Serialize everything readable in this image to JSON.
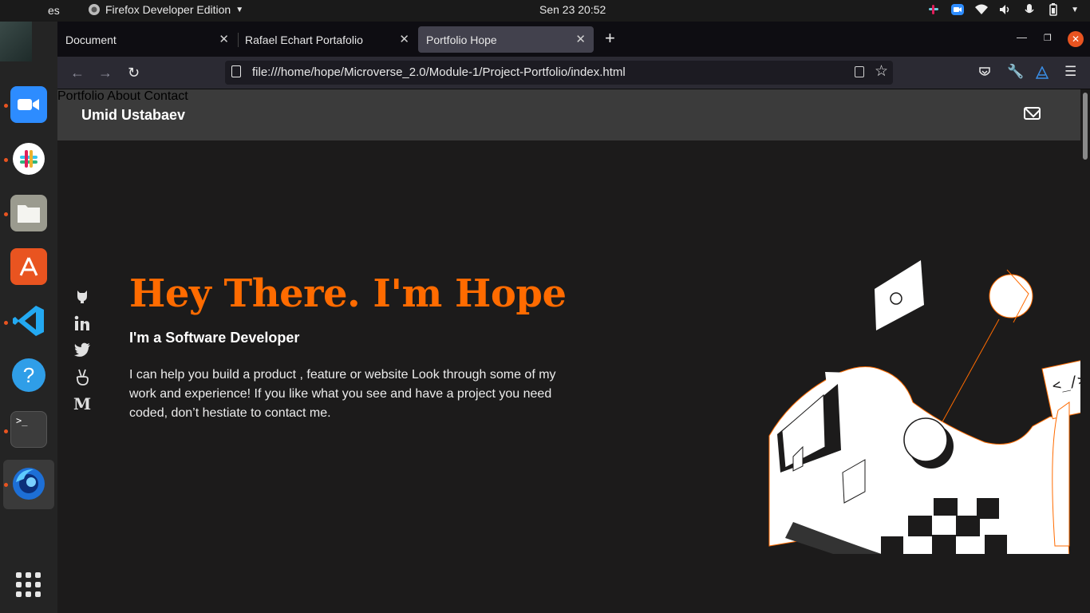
{
  "system": {
    "activities_label": "es",
    "app_menu_label": "Firefox Developer Edition",
    "clock": "Sen 23  20:52"
  },
  "tabs": [
    {
      "title": "Document"
    },
    {
      "title": "Rafael Echart Portafolio"
    },
    {
      "title": "Portfolio Hope",
      "active": true
    }
  ],
  "url": "file:///home/hope/Microverse_2.0/Module-1/Project-Portfolio/index.html",
  "site": {
    "logo": "Umid Ustabaev",
    "nav": [
      "Portfolio",
      "About",
      "Contact"
    ],
    "hero_title": "Hey There. I'm Hope",
    "hero_subtitle": "I'm a Software Developer",
    "hero_text": "I can help you build a product , feature or website Look through some of my work and experience! If you like what you see and have a project you need coded, don’t hestiate to contact me.",
    "medium_letter": "M",
    "accent_color": "#ff6b00"
  },
  "illustration": {
    "code_tag_1": "<_/>",
    "code_tag_2": "<</>"
  },
  "icons": {
    "dock": [
      "zoom-icon",
      "slack-icon",
      "files-icon",
      "app-store-icon",
      "vscode-icon",
      "help-icon",
      "terminal-icon",
      "firefox-icon",
      "app-grid-icon"
    ],
    "social": [
      "github-icon",
      "linkedin-icon",
      "twitter-icon",
      "angellist-icon",
      "medium-icon"
    ]
  }
}
